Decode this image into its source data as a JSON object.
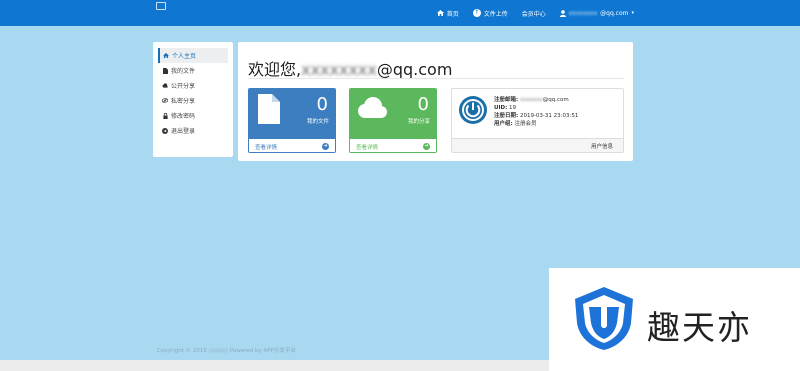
{
  "navbar": {
    "items": [
      {
        "label": "首页",
        "icon": "home-icon"
      },
      {
        "label": "文件上传",
        "icon": "upload-icon"
      },
      {
        "label": "会员中心"
      },
      {
        "user_prefix": "xxxxxxxx",
        "label": "@qq.com",
        "icon": "user-icon"
      }
    ]
  },
  "sidebar": {
    "items": [
      {
        "label": "个人主页",
        "icon": "home-icon",
        "active": true
      },
      {
        "label": "我的文件",
        "icon": "file-icon"
      },
      {
        "label": "公开分享",
        "icon": "cloud-icon"
      },
      {
        "label": "私密分享",
        "icon": "eye-slash-icon"
      },
      {
        "label": "修改密码",
        "icon": "lock-icon"
      },
      {
        "label": "退出登录",
        "icon": "exit-icon"
      }
    ]
  },
  "main": {
    "welcome_prefix": "欢迎您,",
    "welcome_blur": "xxxxxxxx",
    "welcome_suffix": "@qq.com",
    "cards": {
      "files": {
        "count": "0",
        "label": "我的文件",
        "link": "查看详情",
        "color": "#3c7ebf"
      },
      "shares": {
        "count": "0",
        "label": "我的分享",
        "link": "查看详情",
        "color": "#5cb85c"
      }
    },
    "user_panel": {
      "email_label": "注册邮箱:",
      "email_blur": "xxxxxxx",
      "email_suffix": "@qq.com",
      "uid_label": "UID:",
      "uid_value": "19",
      "date_label": "注册日期:",
      "date_value": "2019-03-31 23:03:51",
      "group_label": "用户组:",
      "group_value": "注册会员",
      "footer": "用户信息"
    }
  },
  "footer": {
    "prefix": "Copyright © 2016",
    "blur": "xxxxxx",
    "suffix": "Powered by APP分发平台"
  },
  "watermark": {
    "text": "趣天亦"
  }
}
